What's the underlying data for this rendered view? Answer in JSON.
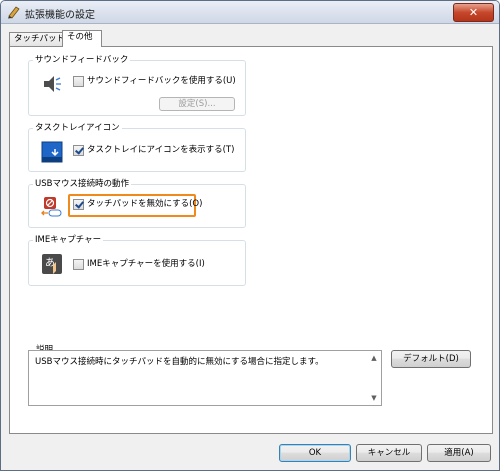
{
  "window": {
    "title": "拡張機能の設定"
  },
  "tabs": [
    {
      "label": "タッチパッド"
    },
    {
      "label": "その他"
    }
  ],
  "groups": {
    "sound": {
      "title": "サウンドフィードバック",
      "checkbox_label": "サウンドフィードバックを使用する(U)",
      "checked": false,
      "settings_button": "設定(S)..."
    },
    "tray": {
      "title": "タスクトレイアイコン",
      "checkbox_label": "タスクトレイにアイコンを表示する(T)",
      "checked": true
    },
    "usb": {
      "title": "USBマウス接続時の動作",
      "checkbox_label": "タッチパッドを無効にする(O)",
      "checked": true
    },
    "ime": {
      "title": "IMEキャプチャー",
      "checkbox_label": "IMEキャプチャーを使用する(I)",
      "checked": false
    }
  },
  "description": {
    "title": "説明",
    "text": "USBマウス接続時にタッチパッドを自動的に無効にする場合に指定します。"
  },
  "buttons": {
    "default": "デフォルト(D)",
    "ok": "OK",
    "cancel": "キャンセル",
    "apply": "適用(A)"
  },
  "colors": {
    "highlight": "#f08a1c",
    "close_button": "#c6472b",
    "tray_icon": "#1e67c8"
  },
  "icons": {
    "sound": "speaker-icon",
    "tray": "tray-window-icon",
    "usb": "usb-mouse-icon",
    "ime": "ime-capture-icon"
  }
}
